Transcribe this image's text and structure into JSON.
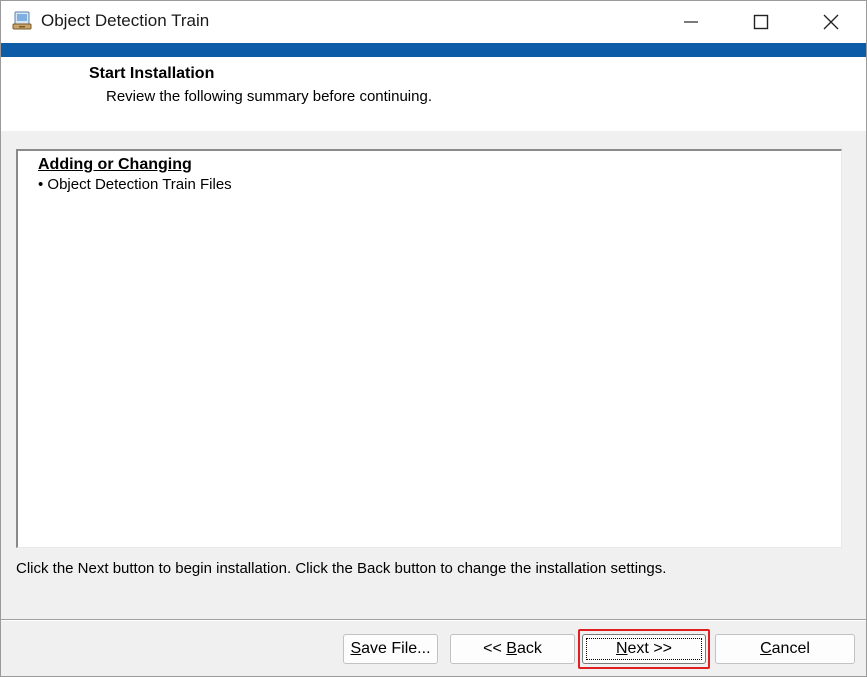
{
  "window": {
    "title": "Object Detection Train",
    "controls": {
      "minimize": "minimize-icon",
      "maximize": "maximize-icon",
      "close": "close-icon"
    }
  },
  "header": {
    "title": "Start Installation",
    "subtitle": "Review the following summary before continuing."
  },
  "summary": {
    "heading": "Adding or Changing",
    "items": [
      "• Object Detection Train Files"
    ]
  },
  "instruction": "Click the Next button to begin installation.  Click the Back button to change the installation settings.",
  "buttons": {
    "save_file": {
      "mnemonic": "S",
      "rest": "ave File..."
    },
    "back": {
      "prefix": "<< ",
      "mnemonic": "B",
      "rest": "ack"
    },
    "next": {
      "mnemonic": "N",
      "rest": "ext >>"
    },
    "cancel": {
      "mnemonic": "C",
      "rest": "ancel"
    }
  },
  "colors": {
    "accent_bar": "#0d5ca8",
    "highlight": "#e02020"
  }
}
